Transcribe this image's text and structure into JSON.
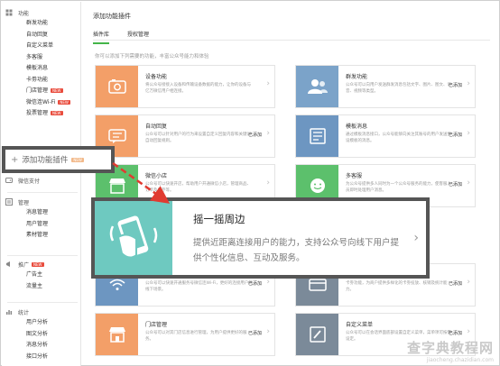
{
  "sidebar": {
    "sections": [
      {
        "heading": "功能",
        "items": [
          {
            "label": "群发功能"
          },
          {
            "label": "自动回复"
          },
          {
            "label": "自定义菜单"
          },
          {
            "label": "多客服"
          },
          {
            "label": "模板消息"
          },
          {
            "label": "卡劵功能"
          },
          {
            "label": "门店管理",
            "badge": "NEW"
          },
          {
            "label": "微信连Wi-Fi",
            "badge": "NEW"
          },
          {
            "label": "投票管理",
            "badge": "NEW"
          }
        ]
      },
      {
        "heading": "微信支付",
        "items": []
      },
      {
        "heading": "管理",
        "items": [
          {
            "label": "消息管理"
          },
          {
            "label": "用户管理"
          },
          {
            "label": "素材管理"
          }
        ]
      },
      {
        "heading": "推广",
        "heading_badge": "NEW",
        "items": [
          {
            "label": "广告主"
          },
          {
            "label": "流量主"
          }
        ]
      },
      {
        "heading": "统计",
        "items": [
          {
            "label": "用户分析"
          },
          {
            "label": "图文分析"
          },
          {
            "label": "消息分析"
          },
          {
            "label": "接口分析"
          }
        ]
      }
    ],
    "add_plugin": {
      "label": "添加功能插件",
      "badge": "NEW"
    }
  },
  "main": {
    "title": "添加功能插件",
    "tabs": [
      {
        "label": "插件库"
      },
      {
        "label": "授权管理"
      }
    ],
    "intro": "你可以添加下列需要的功能，丰富公众号能力和体验",
    "cards": [
      {
        "title": "设备功能",
        "desc": "将公众号接接入设备和传输设备数据的能力，让你的设备与亿万微信用户相连接。",
        "status": "",
        "icon": "device-icon",
        "color": "#f39f68"
      },
      {
        "title": "群发功能",
        "desc": "公众号可以向用户发送群发消息包括文字、图片、图文、语音、视频等类型。",
        "status": "已添加",
        "icon": "users-icon",
        "color": "#7ba3c9"
      },
      {
        "title": "自动回复",
        "desc": "公众号可以针对用户的行为来设置自定义回复内容和关键词自动回复规则。",
        "status": "已添加",
        "icon": "reply-icon",
        "color": "#f39f68"
      },
      {
        "title": "模板消息",
        "desc": "通过模板消息接口，公众号能够向关注其账号的用户发送预设模板的消息。",
        "status": "已添加",
        "icon": "template-icon",
        "color": "#6d96c1"
      },
      {
        "title": "微信小店",
        "desc": "公众号可以快速开店，帮助用户开通微信小店，管理商品、订单及库存等。",
        "status": "",
        "icon": "shop-icon",
        "color": "#5cc06c"
      },
      {
        "title": "多客服",
        "desc": "为公众号提供多人同时为一个公众号服务的能力，使客服人员即时处理用户消息。",
        "status": "已添加",
        "icon": "chat-icon",
        "color": "#5cc06c"
      },
      {
        "title": "",
        "desc": "公众号可以快速开通服务号微信连Wi-Fi，更好的连接用户的线下场景。",
        "status": "已添加",
        "icon": "wifi-icon",
        "color": "#6d96c1"
      },
      {
        "title": "",
        "desc": "卡劵功能，为商户提供多样化的卡劵投放、核销及统计能力。",
        "status": "已添加",
        "icon": "card-icon",
        "color": "#7b8a99"
      },
      {
        "title": "门店管理",
        "desc": "公众号可以对其门店信息进行管理，为用户提供更好的服务。",
        "status": "已添加",
        "icon": "store-icon",
        "color": "#f39f68"
      },
      {
        "title": "自定义菜单",
        "desc": "公众号可以在会话界面底部设置自定义菜单，菜单项可按需设定。",
        "status": "已添加",
        "icon": "menu-icon",
        "color": "#7b8a99"
      }
    ],
    "highlight": {
      "title": "摇一摇周边",
      "desc": "提供近距离连接用户的能力，支持公众号向线下用户提供个性化信息、互动及服务。",
      "icon": "shake-phone-icon",
      "color": "#6ec9c0"
    }
  },
  "watermark": {
    "main": "查字典教程网",
    "sub": "jiaocheng.chazidian.com"
  },
  "colors": {
    "accent": "#44b549",
    "annotation_arrow": "#e03b31",
    "badge": "#e94c3d"
  }
}
